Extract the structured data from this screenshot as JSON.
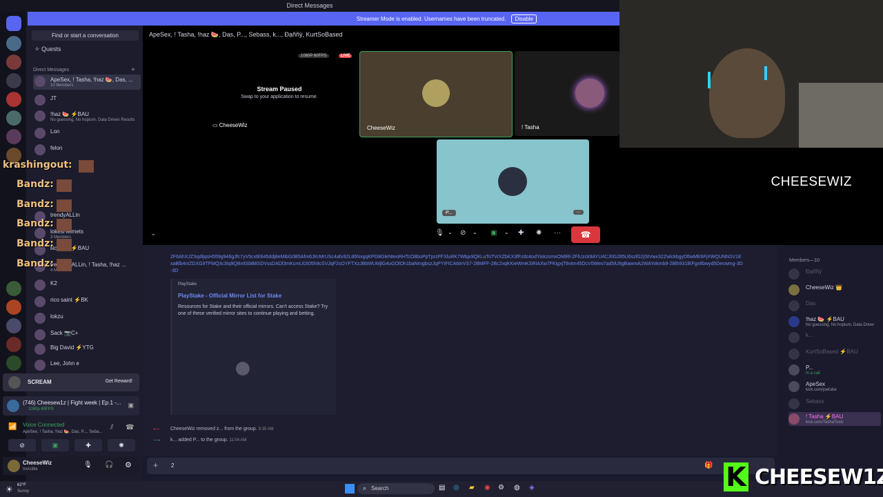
{
  "window": {
    "title": "Direct Messages"
  },
  "streamer_banner": {
    "text": "Streamer Mode is enabled. Usernames have been truncated.",
    "button": "Disable"
  },
  "sidebar": {
    "find": "Find or start a conversation",
    "quests": "Quests",
    "dm_header": "Direct Messages",
    "dms": [
      {
        "name": "ApeSex, ! Tasha, !haz 🍉, Das, ...",
        "sub": "10 Members",
        "selected": true
      },
      {
        "name": "JT",
        "sub": ""
      },
      {
        "name": "!haz 🍉 ⚡BAU",
        "sub": "No guessing, No hopium, Data Driven Results"
      },
      {
        "name": "Lon",
        "sub": ""
      },
      {
        "name": "felon",
        "sub": ""
      },
      {
        "name": "trendyALLin",
        "sub": ""
      },
      {
        "name": "lokesHelmets",
        "sub": "3 Members"
      },
      {
        "name": "lilcwakti ⚡BAU",
        "sub": ""
      },
      {
        "name": "trendyzeALLin, ! Tasha, !haz ...",
        "sub": "4 Members"
      },
      {
        "name": "K2",
        "sub": ""
      },
      {
        "name": "rico saint ⚡BK",
        "sub": ""
      },
      {
        "name": "lokzu",
        "sub": ""
      },
      {
        "name": "Sack 📷C+",
        "sub": ""
      },
      {
        "name": "Big David ⚡YTG",
        "sub": ""
      },
      {
        "name": "Lee, John e",
        "sub": ""
      }
    ],
    "overlay": {
      "krash": "krashingout:",
      "bandz": "Bandz:"
    },
    "banner": {
      "title": "SCREAM",
      "button": "Get Reward!"
    },
    "now_playing": {
      "title": "(746) Cheesew1z | Fight week | Ep.1 -...",
      "sub": "1080p 60FPS"
    },
    "voice": {
      "status": "Voice Connected",
      "sub": "ApeSex, ! Tasha, !haz 🍉, Das, P..., Seba..."
    },
    "profile": {
      "name": "CheeseWiz",
      "status": "Invisible"
    },
    "weather": {
      "temp": "62°F",
      "desc": "Sunny"
    }
  },
  "conversation": {
    "header": "ApeSex, ! Tasha, !haz 🍉, Das, P..., Sebass, k..., Đạññÿ, KurtSoBased"
  },
  "stage": {
    "quality": "1080P 60FPS",
    "live": "LIVE",
    "paused_title": "Stream Paused",
    "paused_sub": "Swap to your application to resume.",
    "streamer_label": "CheeseWiz",
    "tiles": {
      "cheese": "CheeseWiz",
      "tasha": "! Tasha",
      "p": "P..."
    }
  },
  "chat": {
    "link_text": "2F6AhXJZSqdljqsH559g946gJfc7yV5cxtE845ddj8eMibG0B5Afm6JKrMrUSc4afu92L86NxgqKPG8GleNteoRHTcO8boPpTprzFFXluRK7WbpólQKLuToTVrXZbKX3fFzdc4odYiokzsmxOMlRl-2FlUzck9AYU4CJ0G285U6szlG2jStVwx32ZwlckbgyDfIwME6FjXWQUNhGV1ExaBlb4nIZDXG9TFMQ3c3Iq9QBnilSbB8SDVssDADl3mKcmUI2t05h9cSVJqF2sOYFTXzJBbWUMjlG4uGOlOh1baNrngbszJqPYIFICA6inVS7-2BMFF-2Bc2xqKKieWmKSRIAXw7FKigxjT6vtm45DcV0Weo7ad5lU9gBawmA2WAYokmb9-2Blh931lEFgx8bwyd5Decwmg-3D-3D",
    "embed": {
      "source": "PlayStake",
      "title": "PlayStake - Official Mirror List for Stake",
      "desc": "Resources for Stake and their official mirrors. Can't access Stake? Try one of these verified mirror sites to continue playing and betting."
    },
    "system": [
      {
        "text": "CheeseWiz removed z... from the group.",
        "time": "9:35 AM"
      },
      {
        "text": "k... added P... to the group.",
        "time": "11:04 AM"
      }
    ],
    "input_value": "2"
  },
  "members": {
    "header": "Members—10",
    "list": [
      {
        "name": "Đạññÿ",
        "sub": "",
        "dim": true
      },
      {
        "name": "CheeseWiz 👑",
        "sub": "",
        "dim": false
      },
      {
        "name": "Das",
        "sub": "",
        "dim": true
      },
      {
        "name": "!haz 🍉 ⚡BAU",
        "sub": "No guessing, No hopium, Data Driver",
        "dim": false
      },
      {
        "name": "k...",
        "sub": "",
        "dim": true
      },
      {
        "name": "KurtSoBased ⚡BAU",
        "sub": "",
        "dim": true
      },
      {
        "name": "P...",
        "sub": "In a call",
        "dim": false
      },
      {
        "name": "ApeSex",
        "sub": "kick.com/joetube",
        "dim": false
      },
      {
        "name": "Sebass",
        "sub": "",
        "dim": true
      },
      {
        "name": "! Tasha ⚡BAU",
        "sub": "kick.com/TashaToxic",
        "dim": false,
        "selected": true
      }
    ]
  },
  "webcam": {
    "name": "CHEESEWIZ"
  },
  "brand": {
    "logo_text": "CHEESEW1Z"
  },
  "taskbar": {
    "search": "Search"
  }
}
